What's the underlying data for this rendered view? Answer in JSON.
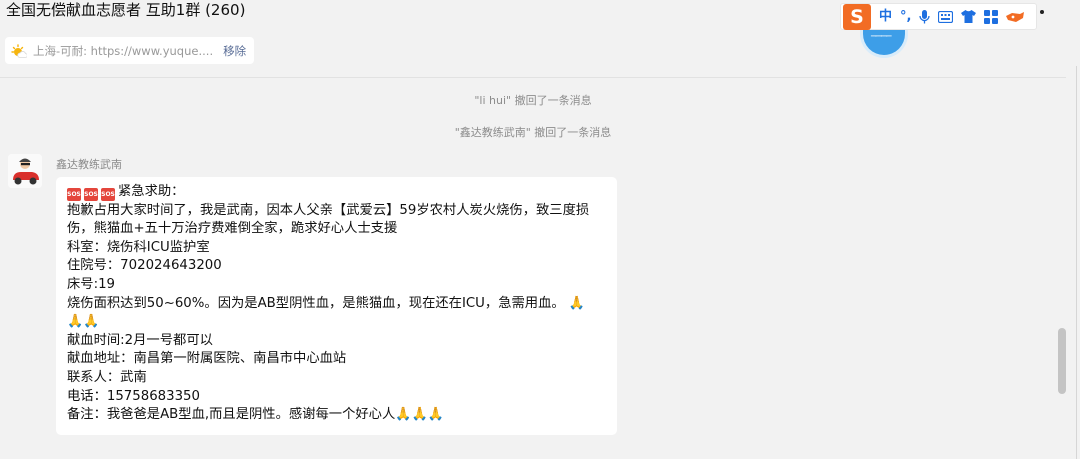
{
  "chat": {
    "title": "全国无偿献血志愿者 互助1群 (260)"
  },
  "pinned": {
    "text": "上海-可耐: https://www.yuque....",
    "remove_label": "移除",
    "icon": "sun-icon"
  },
  "ime": {
    "logo": "S",
    "lang": "中",
    "punct": "°,",
    "icons": [
      "microphone-icon",
      "keyboard-icon",
      "shirt-icon",
      "toolbox-icon",
      "skin-icon"
    ]
  },
  "system_messages": [
    "\"li hui\" 撤回了一条消息",
    "\"鑫达教练武南\" 撤回了一条消息"
  ],
  "message": {
    "sender": "鑫达教练武南",
    "heading": "紧急求助：",
    "sos_label": "SOS",
    "line1": "抱歉占用大家时间了，我是武南，因本人父亲【武爱云】59岁农村人炭火烧伤，致三度损",
    "line2": "伤，熊猫血+五十万治疗费难倒全家，跪求好心人士支援",
    "department": "科室：烧伤科ICU监护室",
    "inpatient_no": "住院号：702024643200",
    "bed_no": "床号:19",
    "burn_info": "烧伤面积达到50~60%。因为是AB型阴性血，是熊猫血，现在还在ICU，急需用血。",
    "donation_time": "献血时间:2月一号都可以",
    "donation_place": "献血地址：南昌第一附属医院、南昌市中心血站",
    "contact": "联系人：武南",
    "phone": "电话：15758683350",
    "note": "备注：我爸爸是AB型血,而且是阴性。感谢每一个好心人",
    "emoji_pray": "🙏"
  },
  "colors": {
    "background": "#f2f2f2",
    "bubble": "#ffffff",
    "link": "#576b95",
    "sos_red": "#e4463c",
    "ime_orange": "#f26c24",
    "ime_blue": "#1e6fe0"
  }
}
